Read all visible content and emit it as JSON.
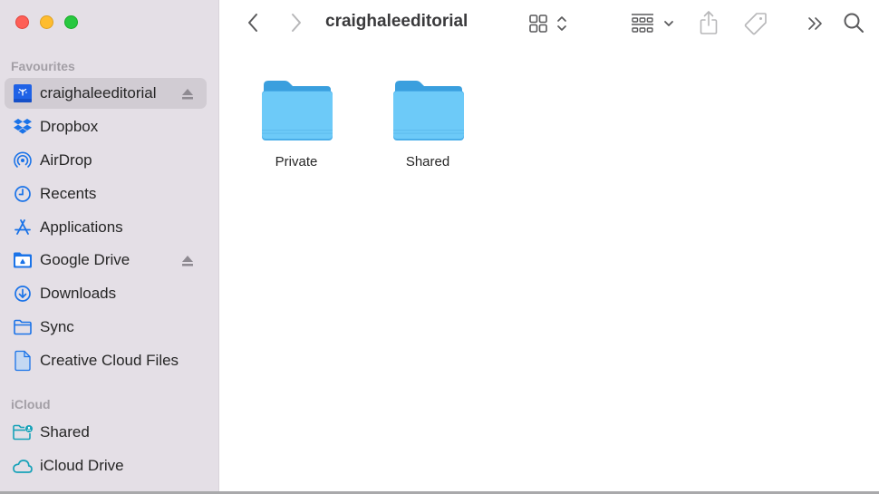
{
  "window": {
    "traffic_lights": [
      "close",
      "minimize",
      "zoom"
    ]
  },
  "sidebar": {
    "sections": [
      {
        "title": "Favourites",
        "items": [
          {
            "label": "craighaleeditorial",
            "icon": "network-drive-icon",
            "selected": true,
            "eject": true
          },
          {
            "label": "Dropbox",
            "icon": "dropbox-icon",
            "selected": false,
            "eject": false
          },
          {
            "label": "AirDrop",
            "icon": "airdrop-icon",
            "selected": false,
            "eject": false
          },
          {
            "label": "Recents",
            "icon": "clock-icon",
            "selected": false,
            "eject": false
          },
          {
            "label": "Applications",
            "icon": "applications-icon",
            "selected": false,
            "eject": false
          },
          {
            "label": "Google Drive",
            "icon": "google-drive-folder-icon",
            "selected": false,
            "eject": true
          },
          {
            "label": "Downloads",
            "icon": "download-icon",
            "selected": false,
            "eject": false
          },
          {
            "label": "Sync",
            "icon": "folder-icon",
            "selected": false,
            "eject": false
          },
          {
            "label": "Creative Cloud Files",
            "icon": "document-icon",
            "selected": false,
            "eject": false
          }
        ]
      },
      {
        "title": "iCloud",
        "items": [
          {
            "label": "Shared",
            "icon": "shared-folder-icon",
            "selected": false,
            "eject": false
          },
          {
            "label": "iCloud Drive",
            "icon": "cloud-icon",
            "selected": false,
            "eject": false
          }
        ]
      }
    ]
  },
  "toolbar": {
    "title": "craighaleeditorial",
    "back": "back",
    "forward": "forward",
    "view_mode": "icon-view",
    "group": "group",
    "share": "share",
    "tags": "tags",
    "more": "more",
    "search": "search"
  },
  "content": {
    "items": [
      {
        "name": "Private",
        "type": "folder"
      },
      {
        "name": "Shared",
        "type": "folder"
      }
    ]
  },
  "colors": {
    "accent": "#1a73e8",
    "icloud_accent": "#17a2b8",
    "sidebar_bg": "#e4dfe6",
    "selected_bg": "#d1ccd3",
    "folder_light": "#6dcaf8",
    "folder_dark": "#3a9fde"
  }
}
